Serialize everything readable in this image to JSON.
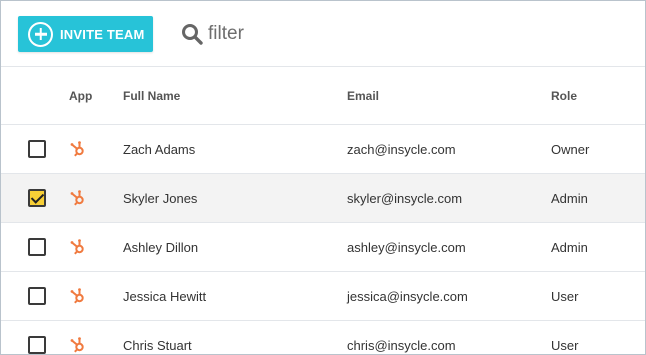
{
  "toolbar": {
    "invite_label": "INVITE TEAM",
    "filter_placeholder": "filter",
    "filter_value": ""
  },
  "table": {
    "headers": {
      "app": "App",
      "name": "Full Name",
      "email": "Email",
      "role": "Role"
    },
    "rows": [
      {
        "name": "Zach Adams",
        "email": "zach@insycle.com",
        "role": "Owner",
        "checked": false,
        "app_icon": "hubspot-icon"
      },
      {
        "name": "Skyler Jones",
        "email": "skyler@insycle.com",
        "role": "Admin",
        "checked": true,
        "app_icon": "hubspot-icon"
      },
      {
        "name": "Ashley Dillon",
        "email": "ashley@insycle.com",
        "role": "Admin",
        "checked": false,
        "app_icon": "hubspot-icon"
      },
      {
        "name": "Jessica Hewitt",
        "email": "jessica@insycle.com",
        "role": "User",
        "checked": false,
        "app_icon": "hubspot-icon"
      },
      {
        "name": "Chris Stuart",
        "email": "chris@insycle.com",
        "role": "User",
        "checked": false,
        "app_icon": "hubspot-icon"
      }
    ]
  },
  "colors": {
    "accent": "#27c3d8",
    "checkbox_checked": "#f7cf36",
    "hubspot_orange": "#f07a3f",
    "selected_row": "#f3f3f3"
  }
}
